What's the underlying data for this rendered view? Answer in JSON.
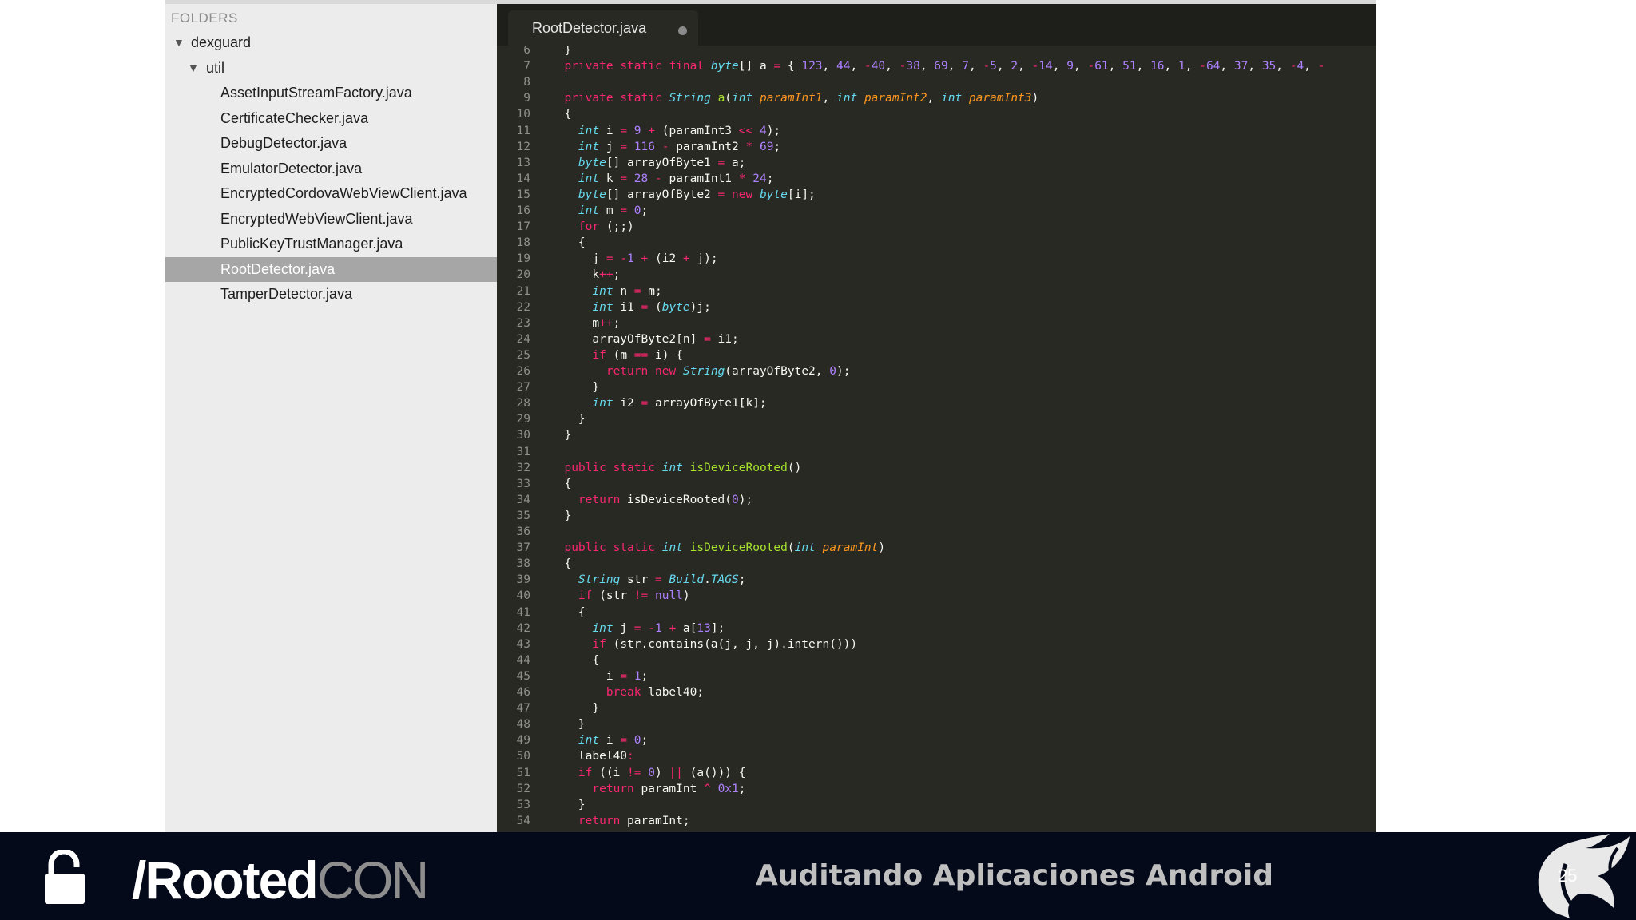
{
  "sidebar": {
    "header": "FOLDERS",
    "tree": [
      {
        "label": "dexguard",
        "expanded": true,
        "depth": 0
      },
      {
        "label": "util",
        "expanded": true,
        "depth": 1
      },
      {
        "label": "AssetInputStreamFactory.java",
        "depth": 2
      },
      {
        "label": "CertificateChecker.java",
        "depth": 2
      },
      {
        "label": "DebugDetector.java",
        "depth": 2
      },
      {
        "label": "EmulatorDetector.java",
        "depth": 2
      },
      {
        "label": "EncryptedCordovaWebViewClient.java",
        "depth": 2
      },
      {
        "label": "EncryptedWebViewClient.java",
        "depth": 2
      },
      {
        "label": "PublicKeyTrustManager.java",
        "depth": 2
      },
      {
        "label": "RootDetector.java",
        "depth": 2,
        "selected": true
      },
      {
        "label": "TamperDetector.java",
        "depth": 2
      }
    ]
  },
  "editor": {
    "tab": {
      "title": "RootDetector.java",
      "modified": true
    },
    "lines": [
      {
        "n": "6",
        "t": "  }"
      },
      {
        "n": "7",
        "t": "  <k>private</k> <k>static</k> <k>final</k> <y>byte</y>[] a <o>=</o> { <u>123</u>, <u>44</u>, <o>-</o><u>40</u>, <o>-</o><u>38</u>, <u>69</u>, <u>7</u>, <o>-</o><u>5</u>, <u>2</u>, <o>-</o><u>14</u>, <u>9</u>, <o>-</o><u>61</u>, <u>51</u>, <u>16</u>, <u>1</u>, <o>-</o><u>64</u>, <u>37</u>, <u>35</u>, <o>-</o><u>4</u>, <o>-</o>"
      },
      {
        "n": "8",
        "t": ""
      },
      {
        "n": "9",
        "t": "  <k>private</k> <k>static</k> <y>String</y> <f>a</f>(<y>int</y> <p>paramInt1</p>, <y>int</y> <p>paramInt2</p>, <y>int</y> <p>paramInt3</p>)"
      },
      {
        "n": "10",
        "t": "  {"
      },
      {
        "n": "11",
        "t": "    <y>int</y> i <o>=</o> <u>9</u> <o>+</o> (paramInt3 <o>&lt;&lt;</o> <u>4</u>);"
      },
      {
        "n": "12",
        "t": "    <y>int</y> j <o>=</o> <u>116</u> <o>-</o> paramInt2 <o>*</o> <u>69</u>;"
      },
      {
        "n": "13",
        "t": "    <y>byte</y>[] arrayOfByte1 <o>=</o> a;"
      },
      {
        "n": "14",
        "t": "    <y>int</y> k <o>=</o> <u>28</u> <o>-</o> paramInt1 <o>*</o> <u>24</u>;"
      },
      {
        "n": "15",
        "t": "    <y>byte</y>[] arrayOfByte2 <o>=</o> <k>new</k> <y>byte</y>[i];"
      },
      {
        "n": "16",
        "t": "    <y>int</y> m <o>=</o> <u>0</u>;"
      },
      {
        "n": "17",
        "t": "    <k>for</k> (;;)"
      },
      {
        "n": "18",
        "t": "    {"
      },
      {
        "n": "19",
        "t": "      j <o>=</o> <o>-</o><u>1</u> <o>+</o> (i2 <o>+</o> j);"
      },
      {
        "n": "20",
        "t": "      k<o>++</o>;"
      },
      {
        "n": "21",
        "t": "      <y>int</y> n <o>=</o> m;"
      },
      {
        "n": "22",
        "t": "      <y>int</y> i1 <o>=</o> (<y>byte</y>)j;"
      },
      {
        "n": "23",
        "t": "      m<o>++</o>;"
      },
      {
        "n": "24",
        "t": "      arrayOfByte2[n] <o>=</o> i1;"
      },
      {
        "n": "25",
        "t": "      <k>if</k> (m <o>==</o> i) {"
      },
      {
        "n": "26",
        "t": "        <k>return</k> <k>new</k> <y>String</y>(arrayOfByte2, <u>0</u>);"
      },
      {
        "n": "27",
        "t": "      }"
      },
      {
        "n": "28",
        "t": "      <y>int</y> i2 <o>=</o> arrayOfByte1[k];"
      },
      {
        "n": "29",
        "t": "    }"
      },
      {
        "n": "30",
        "t": "  }"
      },
      {
        "n": "31",
        "t": ""
      },
      {
        "n": "32",
        "t": "  <k>public</k> <k>static</k> <y>int</y> <f>isDeviceRooted</f>()"
      },
      {
        "n": "33",
        "t": "  {"
      },
      {
        "n": "34",
        "t": "    <k>return</k> isDeviceRooted(<u>0</u>);"
      },
      {
        "n": "35",
        "t": "  }"
      },
      {
        "n": "36",
        "t": ""
      },
      {
        "n": "37",
        "t": "  <k>public</k> <k>static</k> <y>int</y> <f>isDeviceRooted</f>(<y>int</y> <p>paramInt</p>)"
      },
      {
        "n": "38",
        "t": "  {"
      },
      {
        "n": "39",
        "t": "    <y>String</y> str <o>=</o> <y>Build</y>.<y>TAGS</y>;"
      },
      {
        "n": "40",
        "t": "    <k>if</k> (str <o>!=</o> <u>null</u>)"
      },
      {
        "n": "41",
        "t": "    {"
      },
      {
        "n": "42",
        "t": "      <y>int</y> j <o>=</o> <o>-</o><u>1</u> <o>+</o> a[<u>13</u>];"
      },
      {
        "n": "43",
        "t": "      <k>if</k> (str.contains(a(j, j, j).intern()))"
      },
      {
        "n": "44",
        "t": "      {"
      },
      {
        "n": "45",
        "t": "        i <o>=</o> <u>1</u>;"
      },
      {
        "n": "46",
        "t": "        <k>break</k> label40;"
      },
      {
        "n": "47",
        "t": "      }"
      },
      {
        "n": "48",
        "t": "    }"
      },
      {
        "n": "49",
        "t": "    <y>int</y> i <o>=</o> <u>0</u>;"
      },
      {
        "n": "50",
        "t": "    label40<o>:</o>"
      },
      {
        "n": "51",
        "t": "    <k>if</k> ((i <o>!=</o> <u>0</u>) <o>||</o> (a())) {"
      },
      {
        "n": "52",
        "t": "      <k>return</k> paramInt <o>^</o> <u>0x1</u>;"
      },
      {
        "n": "53",
        "t": "    }"
      },
      {
        "n": "54",
        "t": "    <k>return</k> paramInt;"
      }
    ]
  },
  "banner": {
    "brand_left": "/Rooted",
    "brand_right": "CON",
    "title": "Auditando Aplicaciones Android",
    "page_number": "25"
  },
  "colors": {
    "editor_bg": "#282923",
    "keyword": "#f92672",
    "type": "#66d9ef",
    "function": "#a6e22e",
    "param": "#fd971f",
    "number": "#ae81ff",
    "banner_bg": "#050a1b"
  }
}
